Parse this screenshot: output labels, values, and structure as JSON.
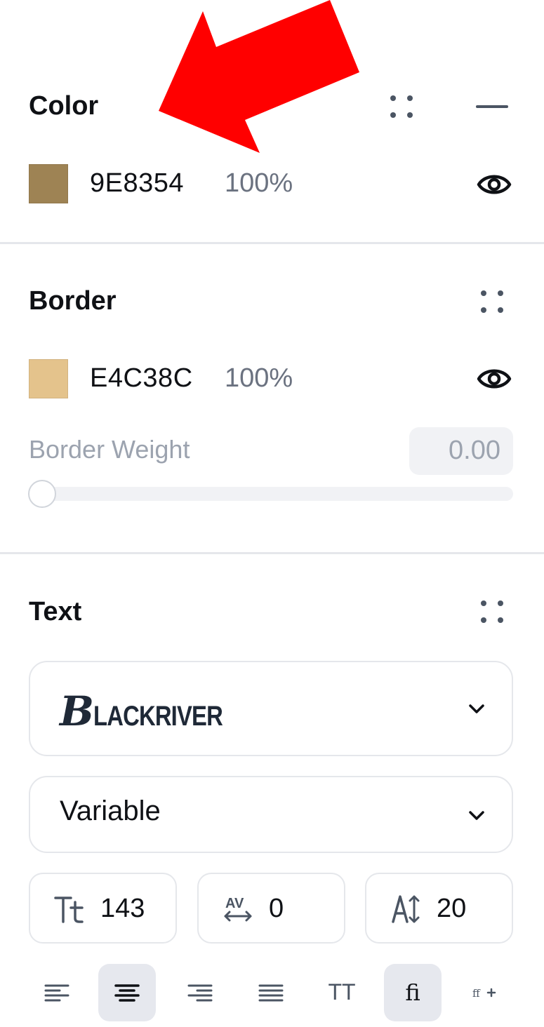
{
  "color_section": {
    "title": "Color",
    "hex": "9E8354",
    "opacity": "100%",
    "swatch_color": "#9E8354"
  },
  "border_section": {
    "title": "Border",
    "hex": "E4C38C",
    "opacity": "100%",
    "swatch_color": "#E4C38C",
    "weight_label": "Border Weight",
    "weight_value": "0.00",
    "weight_slider_fraction": 0
  },
  "text_section": {
    "title": "Text",
    "font_family_first": "B",
    "font_family_rest": "LACKRIVER",
    "font_style": "Variable",
    "font_size": "143",
    "letter_spacing": "0",
    "line_height": "20",
    "align_options": [
      "align-left",
      "align-center",
      "align-right",
      "justify"
    ],
    "active_align": "align-center",
    "uppercase_label": "TT",
    "ligature_label": "fi"
  },
  "annotation": {
    "arrow_color": "#FF0000"
  }
}
